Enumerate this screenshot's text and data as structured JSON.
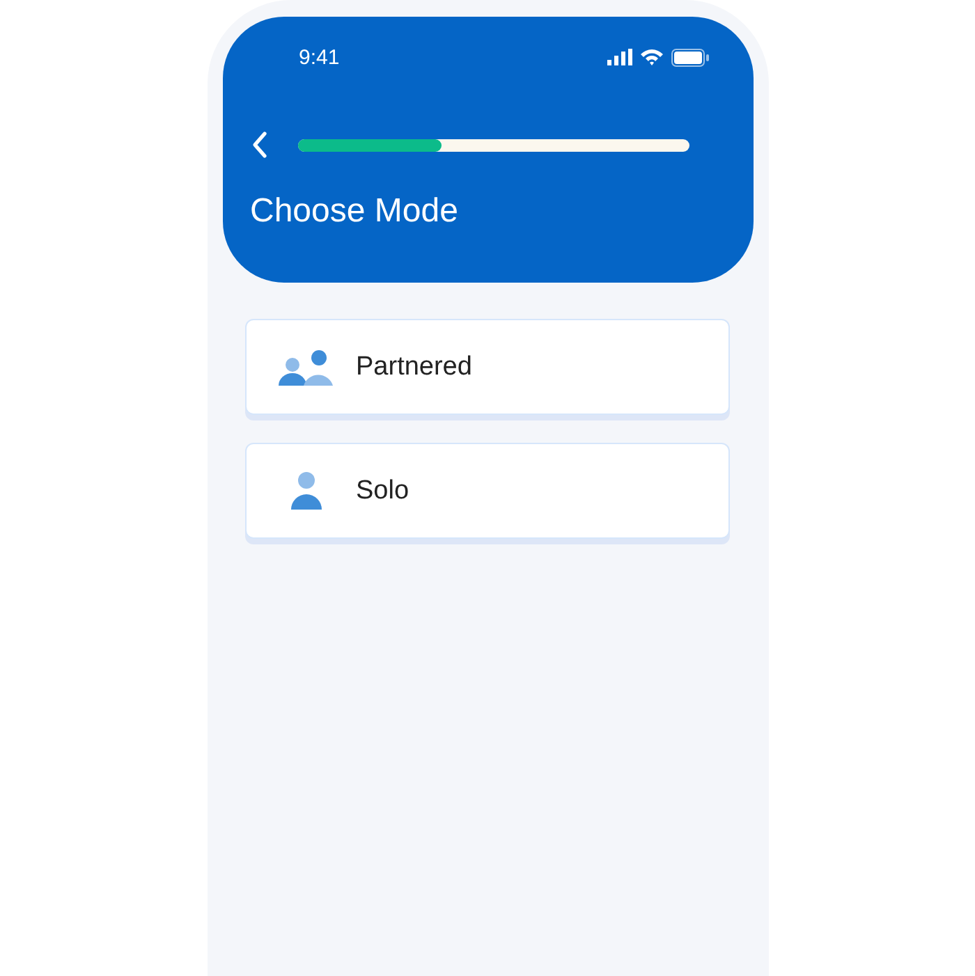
{
  "status_bar": {
    "time": "9:41"
  },
  "header": {
    "progress": {
      "level": 0.37
    },
    "title": "Choose Mode"
  },
  "options": [
    {
      "kind": "pair",
      "label": "Partnered"
    },
    {
      "kind": "single",
      "label": "Solo"
    }
  ]
}
